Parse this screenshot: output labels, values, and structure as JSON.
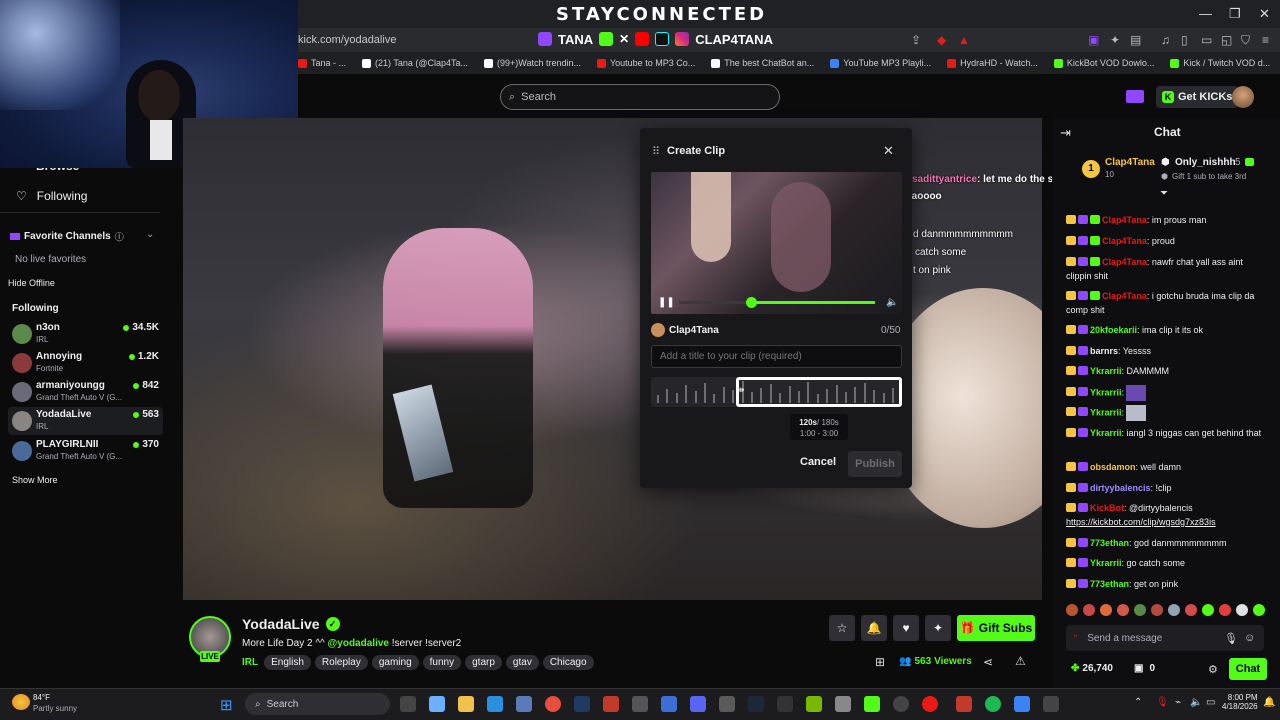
{
  "browser": {
    "banner": "STAYCONNECTED",
    "url": "kick.com/yodadalive",
    "social_handle_1": "TANA",
    "social_handle_2": "CLAP4TANA",
    "bookmarks": [
      {
        "label": "Tana - ...",
        "color": "#e91916"
      },
      {
        "label": "(21) Tana (@Clap4Ta...",
        "color": "#ffffff"
      },
      {
        "label": "(99+)Watch trendin...",
        "color": "#ffffff"
      },
      {
        "label": "Youtube to MP3 Co...",
        "color": "#e91916"
      },
      {
        "label": "The best ChatBot an...",
        "color": "#ffffff"
      },
      {
        "label": "YouTube MP3 Playli...",
        "color": "#3b82f6"
      },
      {
        "label": "HydraHD - Watch...",
        "color": "#e91916"
      },
      {
        "label": "KickBot VOD Dowlo...",
        "color": "#53fc18"
      },
      {
        "label": "Kick / Twitch VOD d...",
        "color": "#53fc18"
      }
    ]
  },
  "header": {
    "search_placeholder": "Search",
    "get_kicks": "Get KICKs"
  },
  "sidebar": {
    "following_nav": "Following",
    "partial_item": "Browse",
    "favorite_channels": "Favorite Channels",
    "no_live_favorites": "No live favorites",
    "hide_offline": "Hide Offline",
    "following_header": "Following",
    "show_more": "Show More",
    "channels": [
      {
        "name": "n3on",
        "game": "IRL",
        "viewers": "34.5K",
        "color": "#5b8a4a"
      },
      {
        "name": "Annoying",
        "game": "Fortnite",
        "viewers": "1.2K",
        "color": "#8a3a3a"
      },
      {
        "name": "armaniyoungg",
        "game": "Grand Theft Auto V (G...",
        "viewers": "842",
        "color": "#6a6a78"
      },
      {
        "name": "YodadaLive",
        "game": "IRL",
        "viewers": "563",
        "color": "#8a8580"
      },
      {
        "name": "PLAYGIRLNII",
        "game": "Grand Theft Auto V (G...",
        "viewers": "370",
        "color": "#4a6a9a"
      }
    ]
  },
  "clip_modal": {
    "title": "Create Clip",
    "channel": "Clap4Tana",
    "char_count": "0/50",
    "title_placeholder": "Add a title to your clip (required)",
    "duration": "120s",
    "duration_max": "/ 180s",
    "range": "1:00 - 3:00",
    "cancel": "Cancel",
    "publish": "Publish"
  },
  "video_overlay": {
    "user": "sadittyantrice",
    "msg1": ": let me do the same thing",
    "msg1b": "lmaoooo",
    "msg2": "d danmmmmmmmmm",
    "msg3": "catch some",
    "msg4": "t on pink"
  },
  "chat": {
    "title": "Chat",
    "pinned_user": "Clap4Tana",
    "pinned_count": "10",
    "top_gifter": "Only_nishhh",
    "top_gifter_count": "5",
    "gift_prompt": "Gift 1 sub to take 3rd",
    "messages": [
      {
        "user": "Clap4Tana",
        "color": "#e91916",
        "text": ": im prous man"
      },
      {
        "user": "Clap4Tana",
        "color": "#e91916",
        "text": ": proud"
      },
      {
        "user": "Clap4Tana",
        "color": "#e91916",
        "text": ": nawfr chat yall ass aint clippin shit"
      },
      {
        "user": "Clap4Tana",
        "color": "#e91916",
        "text": ": i gotchu bruda ima clip da comp shit"
      },
      {
        "user": "20kfoekarii",
        "color": "#53fc18",
        "text": ": ima clip it its ok"
      },
      {
        "user": "barnrs",
        "color": "#efeff1",
        "text": ": Yessss"
      },
      {
        "user": "Ykrarrii",
        "color": "#53fc18",
        "text": ": DAMMMM"
      },
      {
        "user": "Ykrarrii",
        "color": "#53fc18",
        "text": ":"
      },
      {
        "user": "Ykrarrii",
        "color": "#53fc18",
        "text": ":"
      },
      {
        "user": "Ykrarrii",
        "color": "#53fc18",
        "text": ": iangl 3 niggas can get behind that"
      },
      {
        "user": "obsdamon",
        "color": "#f5c542",
        "text": ": well damn"
      },
      {
        "user": "dirtyybalencis",
        "color": "#9b8cff",
        "text": ": !clip"
      },
      {
        "user": "KickBot",
        "color": "#e91916",
        "text": ": @dirtyybalencis"
      },
      {
        "user": "",
        "color": "#efeff1",
        "text": "https://kickbot.com/clip/wgsdg7xz83is"
      },
      {
        "user": "773ethan",
        "color": "#53fc18",
        "text": ": god danmmmmmmmm"
      },
      {
        "user": "Ykrarrii",
        "color": "#53fc18",
        "text": ": go catch some"
      },
      {
        "user": "773ethan",
        "color": "#53fc18",
        "text": ": get on pink"
      }
    ],
    "input_placeholder": "Send a message",
    "kicks_balance": "26,740",
    "sub_count": "0",
    "send": "Chat"
  },
  "stream": {
    "streamer": "YodadaLive",
    "live": "LIVE",
    "title_text": "More Life Day 2 ^^",
    "title_mention": "@yodadalive",
    "title_cmds": "!server !server2",
    "category": "IRL",
    "tags": [
      "English",
      "Roleplay",
      "gaming",
      "funny",
      "gtarp",
      "gtav",
      "Chicago"
    ],
    "viewers": "563",
    "viewers_label": "Viewers",
    "gift_subs": "Gift Subs"
  },
  "taskbar": {
    "weather_temp": "84°F",
    "weather_desc": "Partly sunny",
    "search": "Search",
    "time": "8:00 PM",
    "date": "4/18/2026"
  }
}
